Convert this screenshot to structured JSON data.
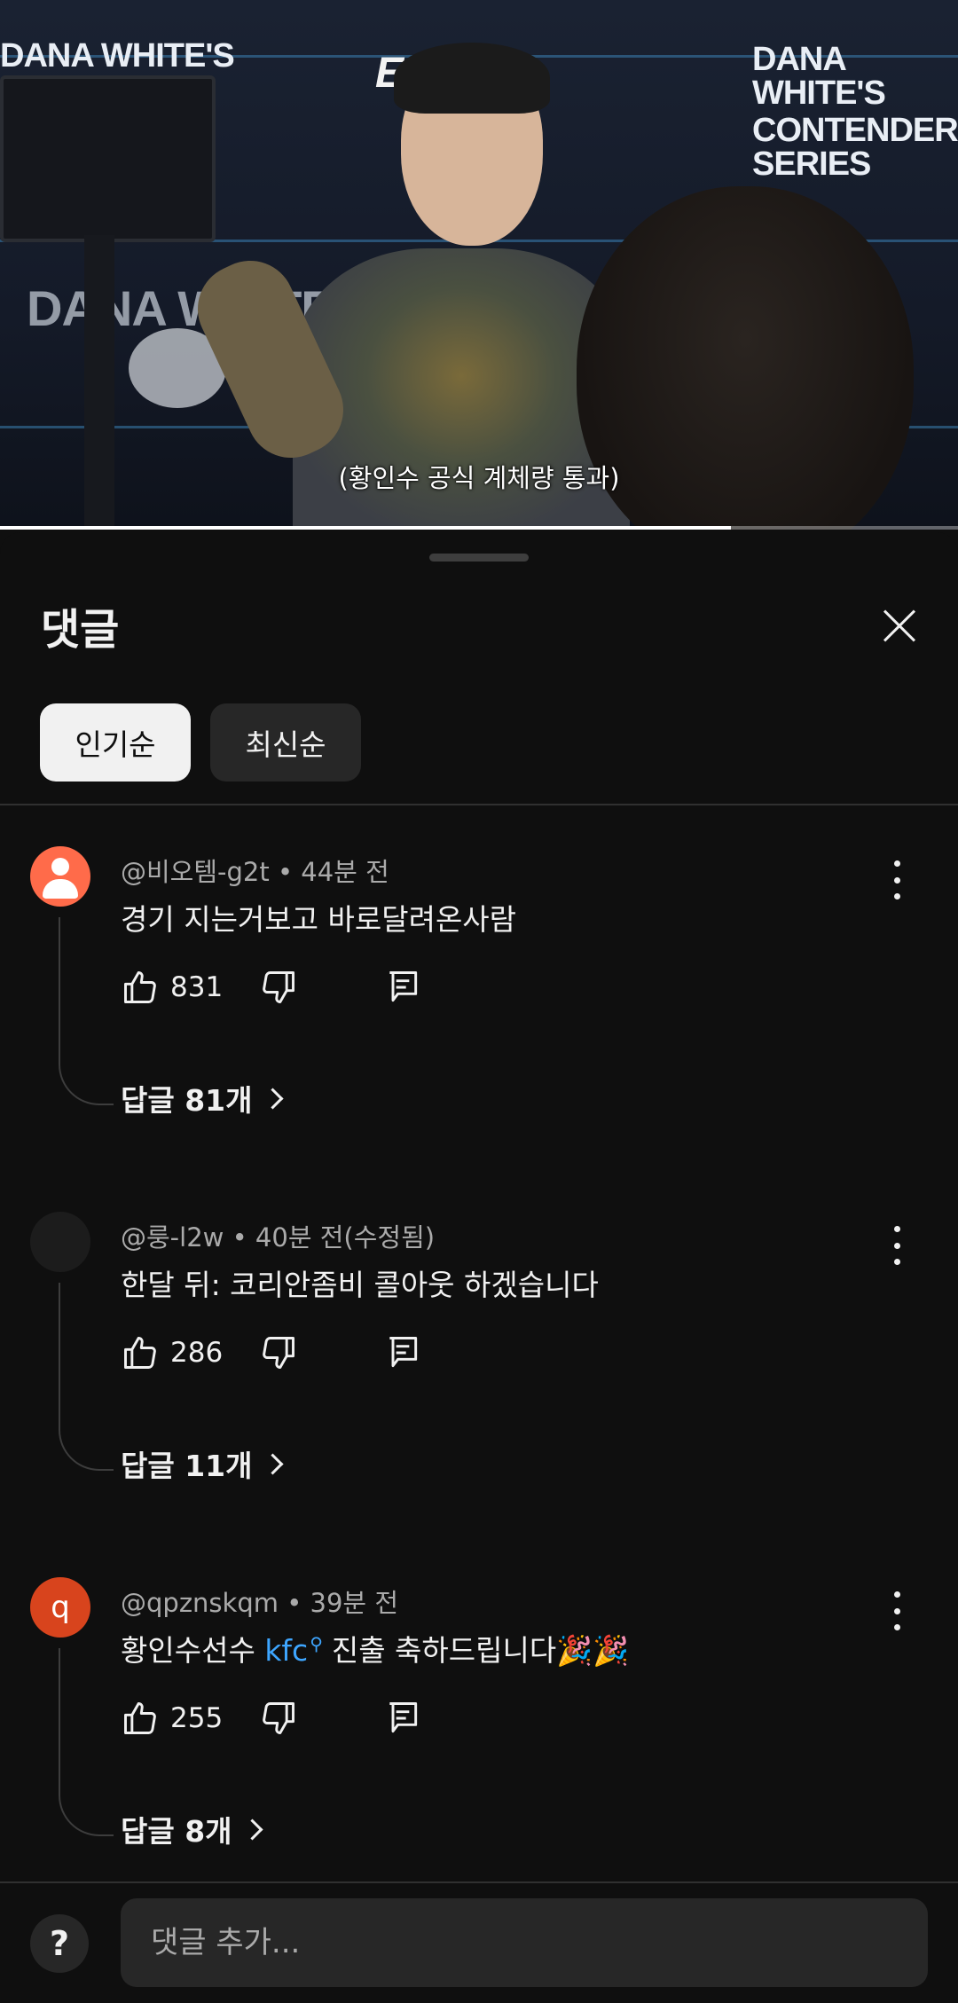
{
  "video": {
    "subtitle": "(황인수 공식 계체량 통과)",
    "wall_logo_line1": "DANA WHITE'S",
    "wall_logo_line2": "CONTENDER SERIES",
    "brand_logo": "ESPN",
    "brand_plus": "+",
    "progress_fraction": 0.763
  },
  "sheet": {
    "title": "댓글",
    "sort_chips": [
      {
        "label": "인기순",
        "selected": true
      },
      {
        "label": "최신순",
        "selected": false
      }
    ]
  },
  "comments": [
    {
      "author": "@비오템-g2t",
      "time": "44분 전",
      "text": "경기 지는거보고 바로달려온사람",
      "likes": "831",
      "replies_label": "답글 81개",
      "avatar": "default-person"
    },
    {
      "author": "@룽-l2w",
      "time": "40분 전(수정됨)",
      "text": "한달 뒤: 코리안좀비 콜아웃 하겠습니다",
      "likes": "286",
      "replies_label": "답글 11개",
      "avatar": "dark"
    },
    {
      "author": "@qpznskqm",
      "time": "39분 전",
      "text_before": "황인수선수",
      "text_link": "kfc",
      "text_after": "진출 축하드립니다🎉🎉",
      "likes": "255",
      "replies_label": "답글 8개",
      "avatar": "q"
    }
  ],
  "composer": {
    "help_label": "?",
    "placeholder": "댓글 추가..."
  },
  "colors": {
    "background": "#0f0f0f",
    "chip_active": "#f1f1f1",
    "chip_inactive": "#272727",
    "link": "#3ea6ff",
    "avatar_orange": "#ff6b4a",
    "avatar_red": "#d8441d"
  }
}
